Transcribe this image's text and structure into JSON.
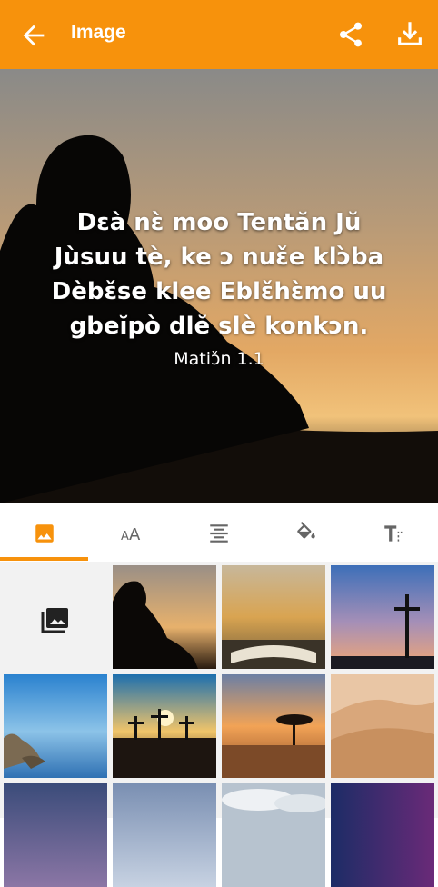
{
  "app": {
    "title": "Image",
    "accent_color": "#f7920c",
    "icons": {
      "back": "arrow-left-icon",
      "share": "share-icon",
      "download": "download-icon"
    }
  },
  "preview": {
    "verse_lines": [
      "Dɛà nɛ̀ moo Tentăn Jŭ",
      "Jùsuu tè, ke ɔ nuɛ̌e klɔ̀ba",
      "Dèbɛ̌se klee Eblɛ̌hɛ̀mo uu",
      "gbeĭpò dlĕ slè konkɔn."
    ],
    "reference": "Matiɔ̌n 1.1"
  },
  "tabs": [
    {
      "name": "background-image",
      "icon": "image-icon",
      "selected": true
    },
    {
      "name": "font-size",
      "icon": "text-size-icon",
      "selected": false
    },
    {
      "name": "text-align",
      "icon": "align-center-icon",
      "selected": false
    },
    {
      "name": "fill-color",
      "icon": "paint-bucket-icon",
      "selected": false
    },
    {
      "name": "text-style",
      "icon": "text-format-icon",
      "selected": false
    }
  ],
  "gallery": {
    "picker_icon": "photo-library-icon",
    "thumbnails": [
      "boy-reading-silhouette",
      "open-bible-sunset",
      "cross-at-dusk",
      "rocky-shore-blue",
      "three-crosses-sunset",
      "acacia-tree-sunset",
      "desert-dunes",
      "dusk-sky",
      "cloudy-sky",
      "clouds-horizon",
      "night-sky"
    ]
  }
}
